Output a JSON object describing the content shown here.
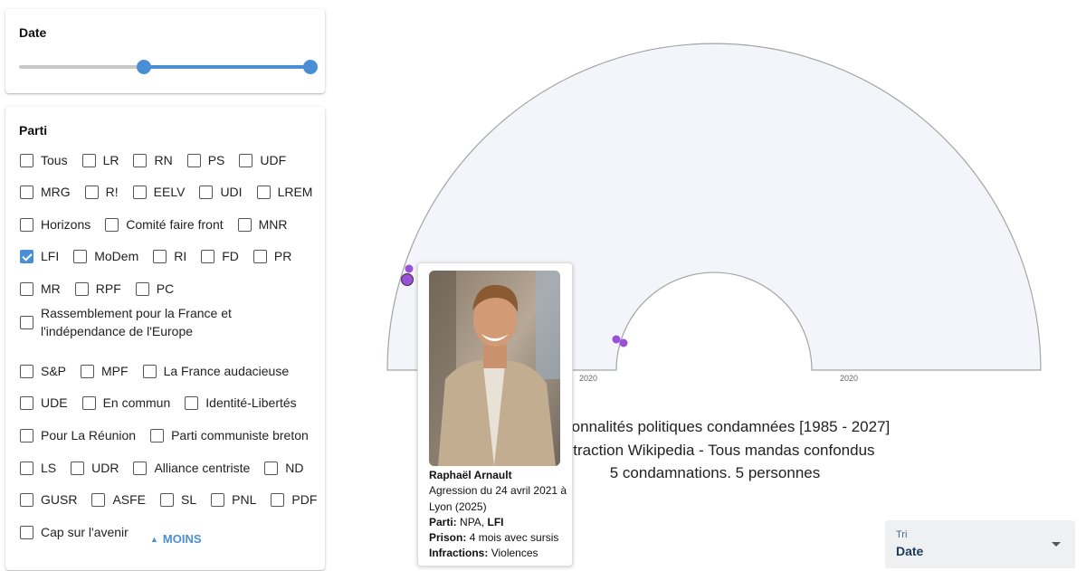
{
  "date_filter": {
    "title": "Date",
    "range_start_fraction": 0.43,
    "range_end_fraction": 1.0,
    "accent_color": "#4a8fd6"
  },
  "party_filter": {
    "title": "Parti",
    "rows": [
      [
        {
          "label": "Tous",
          "checked": false
        },
        {
          "label": "LR",
          "checked": false
        },
        {
          "label": "RN",
          "checked": false
        },
        {
          "label": "PS",
          "checked": false
        },
        {
          "label": "UDF",
          "checked": false
        }
      ],
      [
        {
          "label": "MRG",
          "checked": false
        },
        {
          "label": "R!",
          "checked": false
        },
        {
          "label": "EELV",
          "checked": false
        },
        {
          "label": "UDI",
          "checked": false
        },
        {
          "label": "LREM",
          "checked": false
        }
      ],
      [
        {
          "label": "Horizons",
          "checked": false
        },
        {
          "label": "Comité faire front",
          "checked": false
        },
        {
          "label": "MNR",
          "checked": false
        }
      ],
      [
        {
          "label": "LFI",
          "checked": true
        },
        {
          "label": "MoDem",
          "checked": false
        },
        {
          "label": "RI",
          "checked": false
        },
        {
          "label": "FD",
          "checked": false
        },
        {
          "label": "PR",
          "checked": false
        }
      ],
      [
        {
          "label": "MR",
          "checked": false
        },
        {
          "label": "RPF",
          "checked": false
        },
        {
          "label": "PC",
          "checked": false
        }
      ],
      [
        {
          "label": "Rassemblement pour la France et l'indépendance de l'Europe",
          "checked": false
        }
      ],
      [
        {
          "label": "S&P",
          "checked": false
        },
        {
          "label": "MPF",
          "checked": false
        },
        {
          "label": "La France audacieuse",
          "checked": false
        }
      ],
      [
        {
          "label": "UDE",
          "checked": false
        },
        {
          "label": "En commun",
          "checked": false
        },
        {
          "label": "Identité-Libertés",
          "checked": false
        }
      ],
      [
        {
          "label": "Pour La Réunion",
          "checked": false
        },
        {
          "label": "Parti communiste breton",
          "checked": false
        }
      ],
      [
        {
          "label": "LS",
          "checked": false
        },
        {
          "label": "UDR",
          "checked": false
        },
        {
          "label": "Alliance centriste",
          "checked": false
        },
        {
          "label": "ND",
          "checked": false
        }
      ],
      [
        {
          "label": "GUSR",
          "checked": false
        },
        {
          "label": "ASFE",
          "checked": false
        },
        {
          "label": "SL",
          "checked": false
        },
        {
          "label": "PNL",
          "checked": false
        },
        {
          "label": "PDF",
          "checked": false
        }
      ],
      [
        {
          "label": "Cap sur l'avenir",
          "checked": false
        }
      ]
    ],
    "less_button_label": "MOINS"
  },
  "chart_data": {
    "type": "scatter",
    "outer_axis_label": "2020",
    "inner_axis_label": "2020",
    "point_color": "#9a4fd8",
    "title_lines": [
      "Personnalités politiques condamnées [1985 - 2027]",
      "Extraction Wikipedia - Tous mandas confondus",
      "5 condamnations. 5 personnes"
    ]
  },
  "tooltip": {
    "name": "Raphaël Arnault",
    "description": "Agression du 24 avril 2021 à Lyon (2025)",
    "party_label": "Parti:",
    "party_value": "NPA, ",
    "party_value_bold": "LFI",
    "prison_label": "Prison:",
    "prison_value": "4 mois avec sursis",
    "offenses_label": "Infractions:",
    "offenses_value": "Violences"
  },
  "sort": {
    "label": "Tri",
    "value": "Date"
  }
}
